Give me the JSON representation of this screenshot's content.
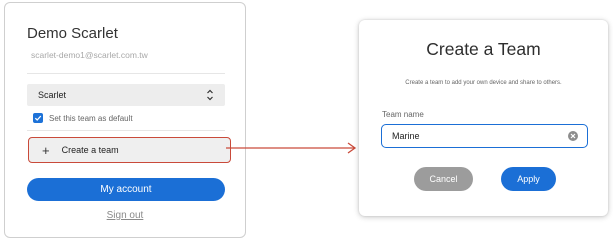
{
  "account_panel": {
    "name": "Demo Scarlet",
    "email": "scarlet-demo1@scarlet.com.tw",
    "team_select": {
      "value": "Scarlet",
      "icon": "chevron-updown-icon"
    },
    "default_checkbox": {
      "label": "Set this team as default",
      "checked": true
    },
    "create_team": {
      "icon": "plus-icon",
      "label": "Create a team",
      "highlight_color": "#c94a3a"
    },
    "my_account_button": "My account",
    "sign_out_link": "Sign out"
  },
  "create_team_dialog": {
    "title": "Create a Team",
    "description": "Create a team to add your own device and share to others.",
    "team_name_label": "Team name",
    "team_name_value": "Marine",
    "clear_icon": "clear-icon",
    "cancel_button": "Cancel",
    "apply_button": "Apply"
  },
  "colors": {
    "accent": "#1b6fd6",
    "annotation": "#c94a3a",
    "cancel": "#9c9c9c"
  }
}
